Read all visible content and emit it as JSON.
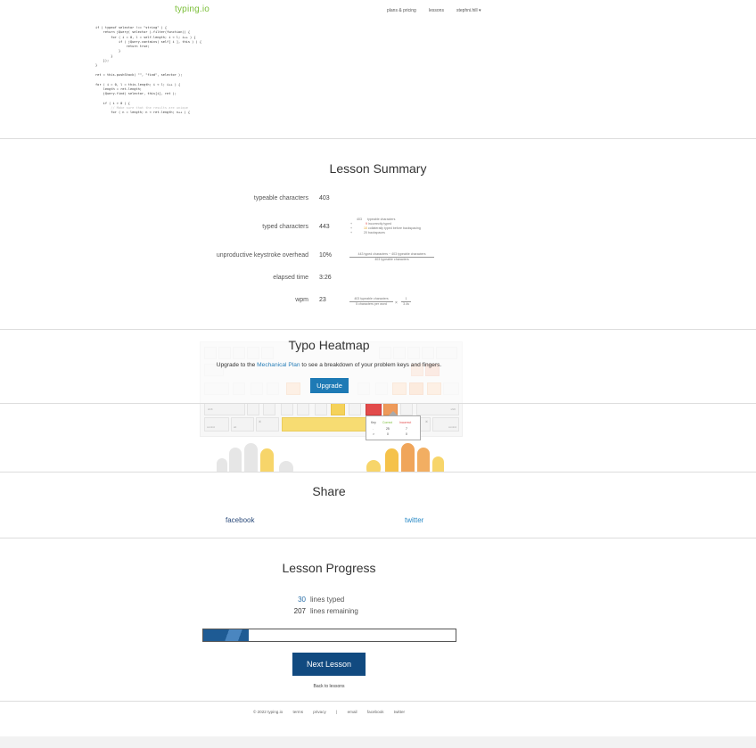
{
  "header": {
    "logo": "typing.io",
    "nav": [
      "plans & pricing",
      "lessons",
      "stephni.hill"
    ]
  },
  "code_lines": [
    "if ( typeof selector !== \"string\" ) {",
    "    return jQuery( selector ).filter(function() {",
    "        for ( i = 0, l = self.length; i < l; i++ ) {",
    "            if ( jQuery.contains( self[ i ], this ) ) {",
    "                return true;",
    "            }",
    "        }",
    "    });",
    "}",
    "",
    "ret = this.pushStack( \"\", \"find\", selector );",
    "",
    "for ( i = 0, l = this.length; i < l; i++ ) {",
    "    length = ret.length;",
    "    jQuery.find( selector, this[i], ret );",
    "",
    "    if ( i > 0 ) {",
    "        // Make sure that the results are unique",
    "        for ( n = length; n < ret.length; n++ ) {"
  ],
  "summary": {
    "title": "Lesson Summary",
    "rows": [
      {
        "label": "typeable characters",
        "value": "403"
      },
      {
        "label": "typed characters",
        "value": "443"
      },
      {
        "label": "unproductive keystroke overhead",
        "value": "10%"
      },
      {
        "label": "elapsed time",
        "value": "3:26"
      },
      {
        "label": "wpm",
        "value": "23"
      }
    ],
    "typed_breakdown": [
      {
        "sign": "",
        "num": "403",
        "text": "typeable characters"
      },
      {
        "sign": "+",
        "num": "9",
        "text": "incorrectly typed"
      },
      {
        "sign": "+",
        "num": "10",
        "text": "collaterally typed before backspacing"
      },
      {
        "sign": "+",
        "num": "20",
        "text": "backspaces"
      }
    ],
    "overhead_formula": {
      "numerator": "443 typed characters − 403 typeable characters",
      "denominator": "403 typeable characters"
    },
    "wpm_formula": {
      "num1": "403 typeable characters",
      "den1": "5 characters per word",
      "times": "×",
      "num2": "1",
      "den2": "3.4s"
    }
  },
  "heatmap": {
    "title": "Typo Heatmap",
    "upgrade_prefix": "Upgrade to the ",
    "upgrade_link": "Mechanical Plan",
    "upgrade_suffix": " to see a breakdown of your problem keys and fingers.",
    "upgrade_button": "Upgrade",
    "tooltip": {
      "headers": [
        "Key",
        "Correct",
        "Incorrect"
      ],
      "rows": [
        [
          ".",
          "25",
          "7"
        ],
        [
          ">",
          "0",
          "0"
        ]
      ]
    },
    "key_labels": [
      "shift",
      "shift",
      "control",
      "alt",
      "⌘",
      "⌘",
      "alt",
      "control"
    ]
  },
  "share": {
    "title": "Share",
    "facebook": "facebook",
    "twitter": "twitter"
  },
  "progress": {
    "title": "Lesson Progress",
    "typed_num": "30",
    "typed_label": "lines typed",
    "remaining_num": "207",
    "remaining_label": "lines remaining",
    "fraction": 0.18,
    "next_button": "Next Lesson",
    "back_link": "Back to lessons"
  },
  "footer": {
    "copyright": "© 2022 typing.io",
    "links": [
      "terms",
      "privacy",
      "|",
      "email",
      "facebook",
      "twitter"
    ]
  },
  "colors": {
    "accent": "#1e7ab5",
    "next_button": "#114a80",
    "logo": "#7cbf3a",
    "heat_yellow": "#f7d56a",
    "heat_orange": "#f0a55a",
    "heat_red": "#e24b4b"
  }
}
